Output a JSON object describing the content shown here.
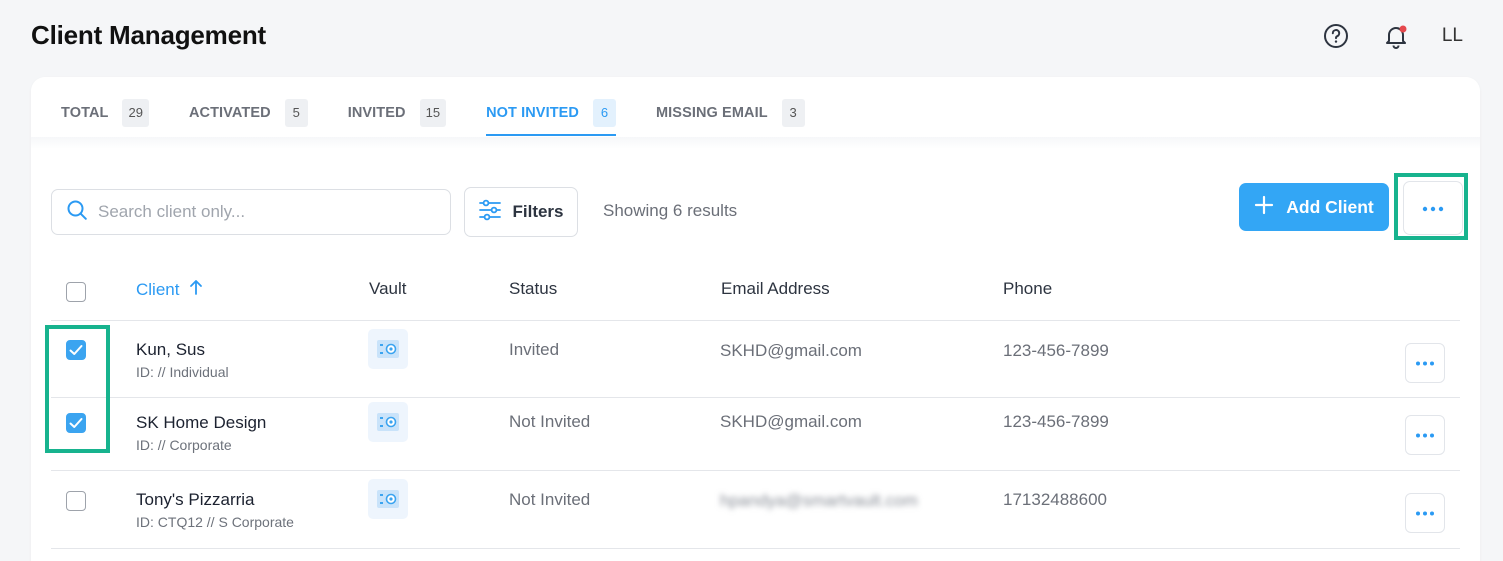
{
  "header": {
    "title": "Client Management",
    "help_icon": "question-circle-icon",
    "bell_icon": "bell-icon",
    "notification_color": "#e5484d",
    "avatar_initials": "LL"
  },
  "tabs": [
    {
      "label": "TOTAL",
      "count": "29",
      "active": false
    },
    {
      "label": "ACTIVATED",
      "count": "5",
      "active": false
    },
    {
      "label": "INVITED",
      "count": "15",
      "active": false
    },
    {
      "label": "NOT INVITED",
      "count": "6",
      "active": true
    },
    {
      "label": "MISSING EMAIL",
      "count": "3",
      "active": false
    }
  ],
  "toolbar": {
    "search_placeholder": "Search client only...",
    "filters_label": "Filters",
    "results_text": "Showing 6 results",
    "add_client_label": "Add Client"
  },
  "table": {
    "columns": {
      "client": "Client",
      "vault": "Vault",
      "status": "Status",
      "email": "Email Address",
      "phone": "Phone"
    },
    "sort_icon": "arrow-up-icon",
    "rows": [
      {
        "name": "Kun, Sus",
        "sub": "ID: // Individual",
        "status": "Invited",
        "email": "SKHD@gmail.com",
        "phone": "123-456-7899",
        "checked": true
      },
      {
        "name": "SK Home Design",
        "sub": "ID: // Corporate",
        "status": "Not Invited",
        "email": "SKHD@gmail.com",
        "phone": "123-456-7899",
        "checked": true
      },
      {
        "name": "Tony's Pizzarria",
        "sub": "ID: CTQ12 // S Corporate",
        "status": "Not Invited",
        "email": "hpandya@smartvault.com",
        "phone": "17132488600",
        "checked": false
      }
    ]
  },
  "colors": {
    "accent": "#2b9af3",
    "primary_button": "#33a6f5",
    "highlight": "#17b38e"
  }
}
